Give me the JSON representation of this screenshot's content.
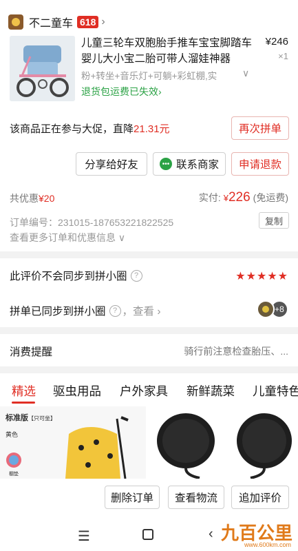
{
  "shop": {
    "name": "不二童车",
    "badge": "618",
    "chevron": "›"
  },
  "product": {
    "title": "儿童三轮车双胞胎手推车宝宝脚踏车婴儿大小宝二胎可带人溜娃神器",
    "price": "¥246",
    "qty": "×1",
    "spec": "粉+转坐+音乐灯+可躺+彩虹棚,实",
    "spec_chevron": "∨",
    "return_note": "退货包运费已失效›"
  },
  "promo": {
    "text": "该商品正在参与大促，直降",
    "amount": "21.31元"
  },
  "buttons": {
    "rejoin": "再次拼单",
    "share": "分享给好友",
    "contact": "联系商家",
    "refund": "申请退款",
    "copy": "复制"
  },
  "summary": {
    "saved_label": "共优惠",
    "saved_amount": "¥20",
    "paid_label": "实付:",
    "paid_currency": "¥",
    "paid_amount": "226",
    "paid_note": "(免运费)",
    "order_no": "订单编号：231015-187653221822525",
    "more_link": "查看更多订单和优惠信息 ∨"
  },
  "review": {
    "not_synced": "此评价不会同步到拼小圈",
    "stars": "★★★★★",
    "synced": "拼单已同步到拼小圈",
    "look": "，查看 ›",
    "avatar_count": "+8"
  },
  "reminder": {
    "title": "消费提醒",
    "text": "骑行前注意检查胎压、..."
  },
  "tabs": [
    "精选",
    "驱虫用品",
    "户外家具",
    "新鲜蔬菜",
    "儿童特色"
  ],
  "goods": {
    "label": "标准版",
    "tag": "【只可坐】",
    "color": "黄色",
    "shade": "棚垫"
  },
  "bottom_actions": {
    "delete": "删除订单",
    "logistics": "查看物流",
    "append_review": "追加评价"
  },
  "watermark": {
    "brand": "九百公里",
    "url": "www.600km.com"
  },
  "colors": {
    "accent": "#e02e24",
    "green": "#2ba245"
  }
}
